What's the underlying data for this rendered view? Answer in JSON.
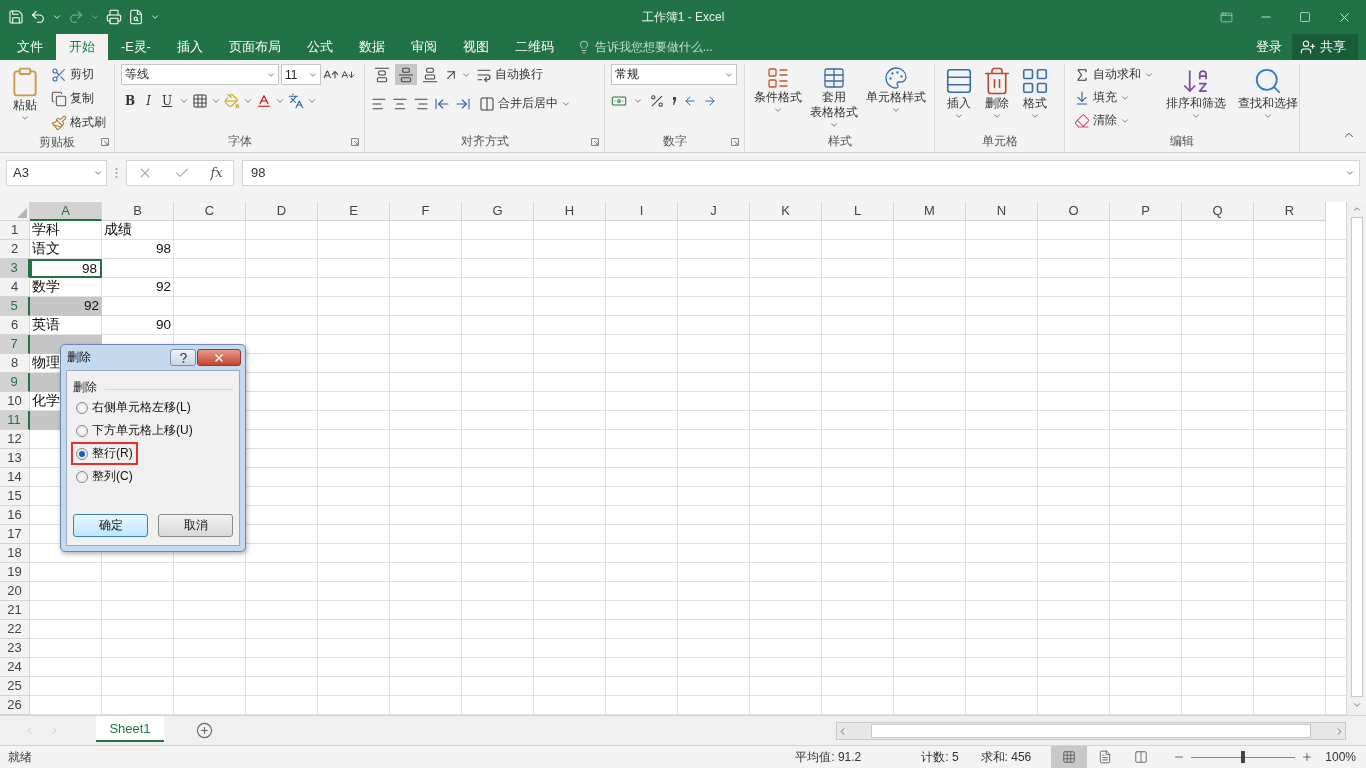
{
  "window": {
    "title": "工作簿1 - Excel"
  },
  "ribbon_tabs": [
    {
      "label": "文件",
      "selected": false
    },
    {
      "label": "开始",
      "selected": true
    },
    {
      "label": "-E灵-",
      "selected": false
    },
    {
      "label": "插入",
      "selected": false
    },
    {
      "label": "页面布局",
      "selected": false
    },
    {
      "label": "公式",
      "selected": false
    },
    {
      "label": "数据",
      "selected": false
    },
    {
      "label": "审阅",
      "selected": false
    },
    {
      "label": "视图",
      "selected": false
    },
    {
      "label": "二维码",
      "selected": false
    }
  ],
  "tell_me": {
    "placeholder": "告诉我您想要做什么..."
  },
  "account": {
    "sign_in": "登录",
    "share": "共享"
  },
  "ribbon_groups": [
    {
      "kind": "clipboard",
      "label": "剪贴板",
      "paste": "粘贴",
      "items": [
        "剪切",
        "复制",
        "格式刷"
      ]
    },
    {
      "kind": "font",
      "label": "字体",
      "font": "等线",
      "size": "11",
      "styles": [
        "B",
        "I",
        "U"
      ]
    },
    {
      "kind": "alignment",
      "label": "对齐方式",
      "vertical_align": [
        {
          "kind": "top",
          "selected": false
        },
        {
          "kind": "middle",
          "selected": true
        },
        {
          "kind": "bottom",
          "selected": false
        }
      ],
      "wrap": "自动换行",
      "merge": "合并后居中"
    },
    {
      "kind": "number",
      "label": "数字",
      "format": "常规"
    },
    {
      "kind": "styles",
      "label": "样式",
      "items": [
        {
          "lines": [
            "条件格式"
          ]
        },
        {
          "lines": [
            "套用",
            "表格格式"
          ]
        },
        {
          "lines": [
            "单元格样式"
          ]
        }
      ]
    },
    {
      "kind": "cells",
      "label": "单元格",
      "items": [
        "插入",
        "删除",
        "格式"
      ]
    },
    {
      "kind": "editing",
      "label": "编辑",
      "small": [
        "自动求和",
        "填充",
        "清除"
      ],
      "big": [
        "排序和筛选",
        "查找和选择"
      ]
    }
  ],
  "formula_bar": {
    "name_box": "A3",
    "fx": "fx",
    "value": "98"
  },
  "columns": [
    {
      "label": "A",
      "selected": true
    },
    {
      "label": "B",
      "selected": false
    },
    {
      "label": "C",
      "selected": false
    },
    {
      "label": "D",
      "selected": false
    },
    {
      "label": "E",
      "selected": false
    },
    {
      "label": "F",
      "selected": false
    },
    {
      "label": "G",
      "selected": false
    },
    {
      "label": "H",
      "selected": false
    },
    {
      "label": "I",
      "selected": false
    },
    {
      "label": "J",
      "selected": false
    },
    {
      "label": "K",
      "selected": false
    },
    {
      "label": "L",
      "selected": false
    },
    {
      "label": "M",
      "selected": false
    },
    {
      "label": "N",
      "selected": false
    },
    {
      "label": "O",
      "selected": false
    },
    {
      "label": "P",
      "selected": false
    },
    {
      "label": "Q",
      "selected": false
    },
    {
      "label": "R",
      "selected": false
    }
  ],
  "rows": [
    {
      "label": "1",
      "selected": false,
      "cells": [
        {
          "text": "学科",
          "kind": "text",
          "active": false
        },
        {
          "text": "成绩",
          "kind": "text",
          "active": false
        }
      ]
    },
    {
      "label": "2",
      "selected": false,
      "cells": [
        {
          "text": "语文",
          "kind": "text",
          "active": false
        },
        {
          "text": "98",
          "kind": "number",
          "active": false
        }
      ]
    },
    {
      "label": "3",
      "selected": true,
      "cells": [
        {
          "text": "98",
          "kind": "number",
          "active": true
        }
      ]
    },
    {
      "label": "4",
      "selected": false,
      "cells": [
        {
          "text": "数学",
          "kind": "text",
          "active": false
        },
        {
          "text": "92",
          "kind": "number",
          "active": false
        }
      ]
    },
    {
      "label": "5",
      "selected": true,
      "cells": [
        {
          "text": "92",
          "kind": "number",
          "active": false
        }
      ]
    },
    {
      "label": "6",
      "selected": false,
      "cells": [
        {
          "text": "英语",
          "kind": "text",
          "active": false
        },
        {
          "text": "90",
          "kind": "number",
          "active": false
        }
      ]
    },
    {
      "label": "7",
      "selected": true
    },
    {
      "label": "8",
      "selected": false,
      "cells": [
        {
          "text": "物理",
          "kind": "text",
          "active": false
        }
      ]
    },
    {
      "label": "9",
      "selected": true
    },
    {
      "label": "10",
      "selected": false,
      "cells": [
        {
          "text": "化学",
          "kind": "text",
          "active": false
        }
      ]
    },
    {
      "label": "11",
      "selected": true
    },
    {
      "label": "12",
      "selected": false
    },
    {
      "label": "13",
      "selected": false
    },
    {
      "label": "14",
      "selected": false
    },
    {
      "label": "15",
      "selected": false
    },
    {
      "label": "16",
      "selected": false
    },
    {
      "label": "17",
      "selected": false
    },
    {
      "label": "18",
      "selected": false
    },
    {
      "label": "19",
      "selected": false
    },
    {
      "label": "20",
      "selected": false
    },
    {
      "label": "21",
      "selected": false
    },
    {
      "label": "22",
      "selected": false
    },
    {
      "label": "23",
      "selected": false
    },
    {
      "label": "24",
      "selected": false
    },
    {
      "label": "25",
      "selected": false
    },
    {
      "label": "26",
      "selected": false
    }
  ],
  "dialog": {
    "title": "删除",
    "group_label": "删除",
    "options": [
      {
        "label": "右侧单元格左移(L)",
        "selected": false,
        "highlighted": false
      },
      {
        "label": "下方单元格上移(U)",
        "selected": false,
        "highlighted": false
      },
      {
        "label": "整行(R)",
        "selected": true,
        "highlighted": true
      },
      {
        "label": "整列(C)",
        "selected": false,
        "highlighted": false
      }
    ],
    "buttons": [
      {
        "label": "确定",
        "kind": "default"
      },
      {
        "label": "取消",
        "kind": "normal"
      }
    ]
  },
  "sheet_tabs": [
    {
      "label": "Sheet1",
      "selected": true
    }
  ],
  "status_bar": {
    "ready": "就绪",
    "average": "平均值: 91.2",
    "count": "计数: 5",
    "sum": "求和: 456",
    "view_modes": [
      {
        "kind": "normal",
        "selected": true
      },
      {
        "kind": "page_layout",
        "selected": false
      },
      {
        "kind": "page_break",
        "selected": false
      }
    ],
    "zoom": {
      "level": 0.5,
      "label": "100%"
    }
  }
}
